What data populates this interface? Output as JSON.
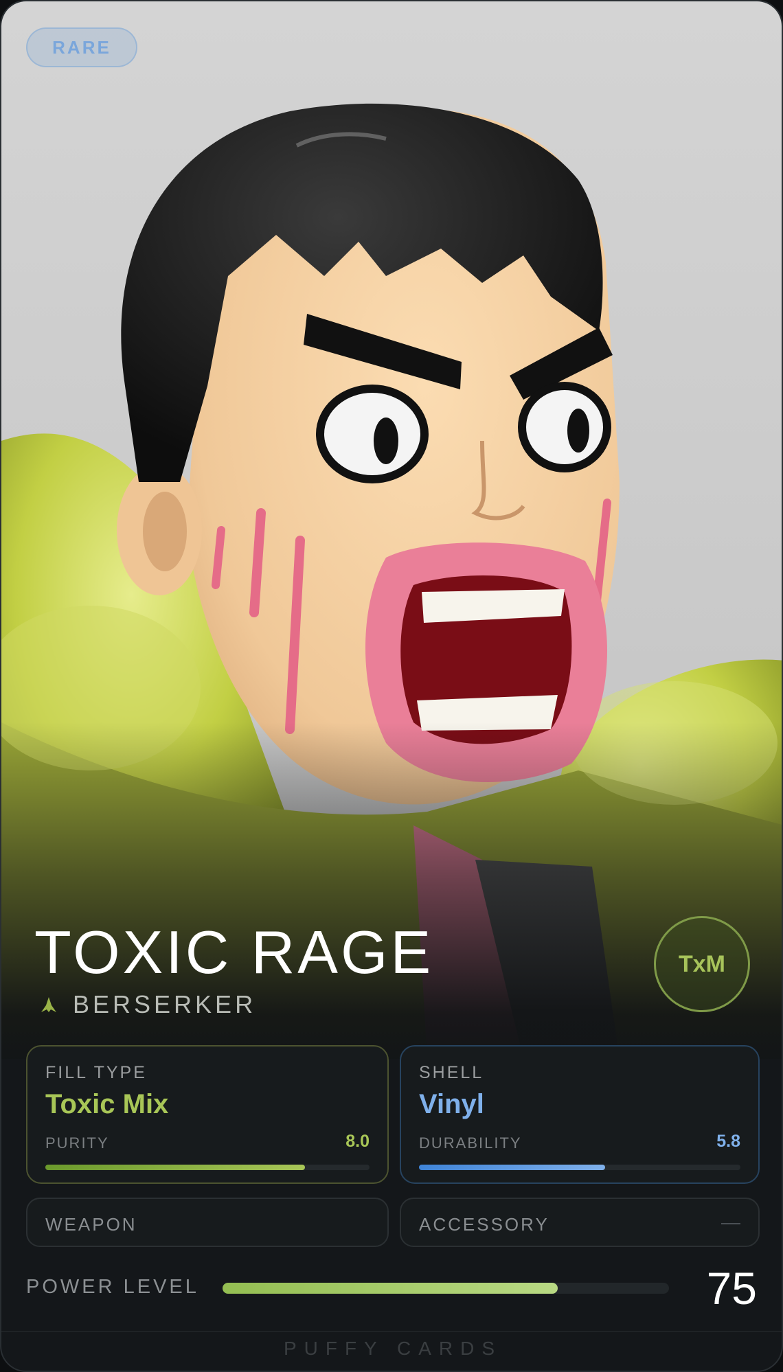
{
  "card": {
    "rarity": "RARE",
    "title": "TOXIC RAGE",
    "class_icon": "claw-icon",
    "class_label": "BERSERKER",
    "maker_logo": "TxM"
  },
  "fill": {
    "label": "FILL TYPE",
    "value": "Toxic Mix",
    "metric_label": "PURITY",
    "metric_value": "8.0",
    "metric_fraction": 0.8
  },
  "shell": {
    "label": "SHELL",
    "value": "Vinyl",
    "metric_label": "DURABILITY",
    "metric_value": "5.8",
    "metric_fraction": 0.58
  },
  "weapon": {
    "label": "WEAPON"
  },
  "accessory": {
    "label": "ACCESSORY",
    "value": "—"
  },
  "power": {
    "label": "POWER LEVEL",
    "value": "75",
    "fraction": 0.75
  },
  "footer": {
    "brand": "PUFFY CARDS"
  },
  "colors": {
    "toxic_green": "#a8c657",
    "vinyl_blue": "#7fb0ea",
    "rare_blue": "#6ea0dc"
  }
}
